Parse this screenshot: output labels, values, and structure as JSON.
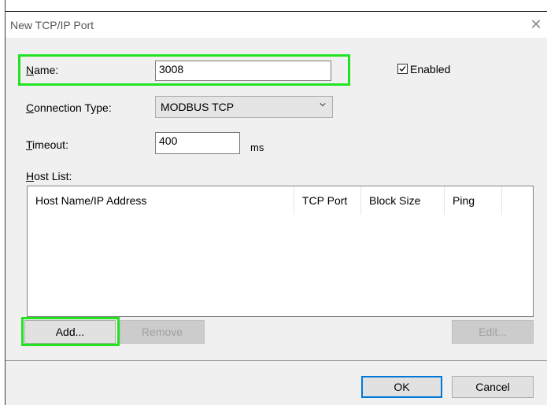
{
  "window": {
    "title": "New TCP/IP Port",
    "close_symbol": "✕"
  },
  "name": {
    "label_key": "N",
    "label_rest": "ame:",
    "value": "3008"
  },
  "enabled": {
    "label": "Enabled",
    "checked": true
  },
  "connection_type": {
    "label_key": "C",
    "label_rest": "onnection Type:",
    "value": "MODBUS TCP"
  },
  "timeout": {
    "label_key": "T",
    "label_rest": "imeout:",
    "value": "400",
    "unit": "ms"
  },
  "host_list": {
    "label_key": "H",
    "label_rest": "ost List:",
    "columns": [
      "Host Name/IP Address",
      "TCP Port",
      "Block Size",
      "Ping"
    ]
  },
  "buttons": {
    "add": "Add...",
    "remove": "Remove",
    "edit": "Edit...",
    "ok": "OK",
    "cancel": "Cancel"
  },
  "colors": {
    "highlight": "#22e322",
    "accent": "#0078d7",
    "dialog_bg": "#f0f0f0"
  }
}
